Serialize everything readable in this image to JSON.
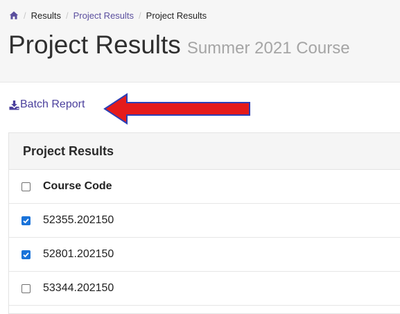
{
  "breadcrumb": {
    "home_icon": "home-icon",
    "items": [
      {
        "label": "Results",
        "link": false
      },
      {
        "label": "Project Results",
        "link": true
      },
      {
        "label": "Project Results",
        "link": false
      }
    ],
    "separator": "/"
  },
  "page": {
    "title": "Project Results",
    "subtitle": "Summer 2021 Course"
  },
  "batch_report": {
    "icon": "download-icon",
    "label": "Batch Report"
  },
  "annotation": {
    "arrow_color": "#e51b1b",
    "arrow_outline": "#2c3fb5"
  },
  "panel": {
    "title": "Project Results",
    "column_header": "Course Code",
    "header_checked": false,
    "rows": [
      {
        "code": "52355.202150",
        "checked": true
      },
      {
        "code": "52801.202150",
        "checked": true
      },
      {
        "code": "53344.202150",
        "checked": false
      }
    ]
  },
  "colors": {
    "link": "#5b4f9e",
    "checkbox_checked": "#1a73d9"
  }
}
